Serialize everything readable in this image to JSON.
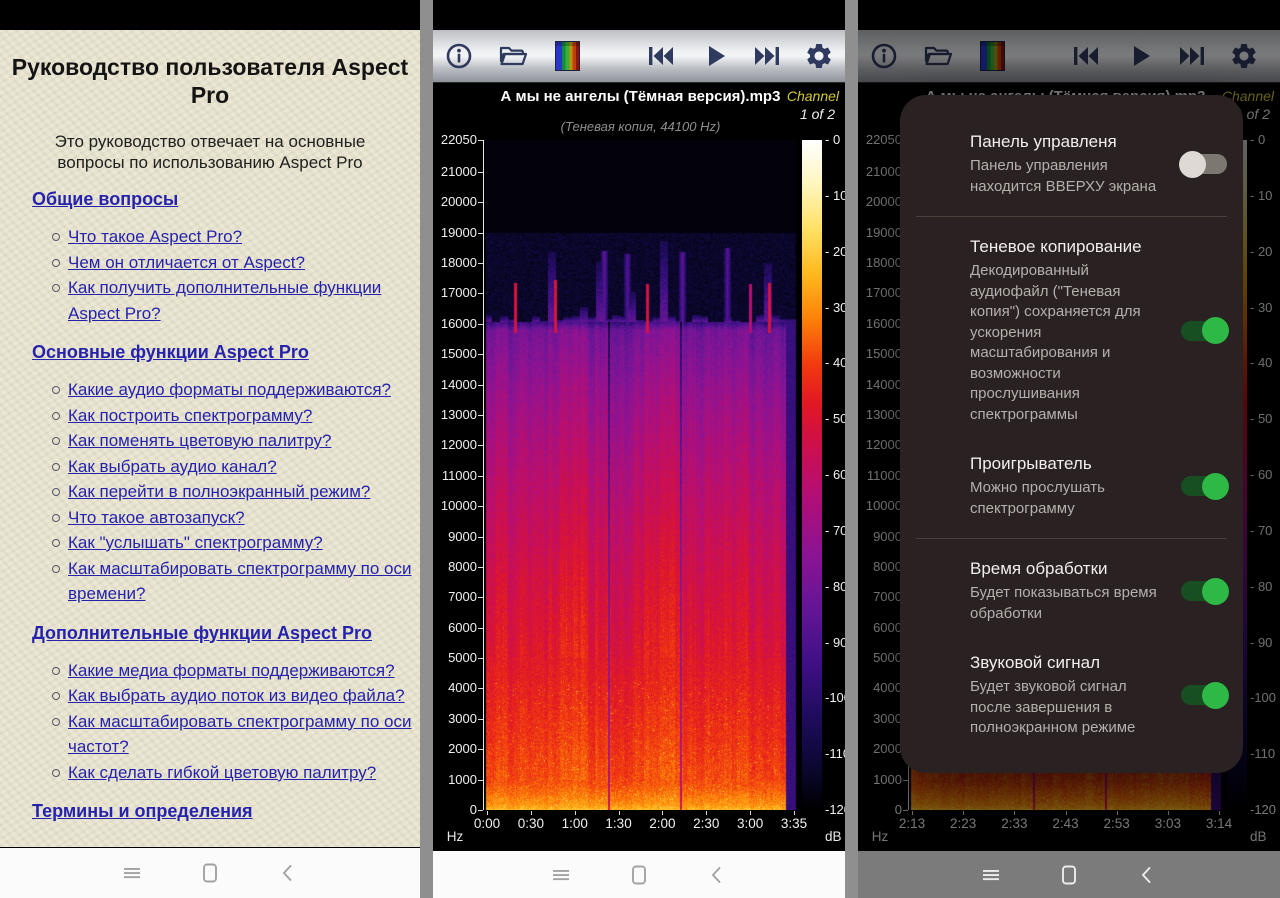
{
  "manual": {
    "title": "Руководство пользователя Aspect Pro",
    "intro": "Это руководство отвечает на основные вопросы по использованию Aspect Pro",
    "sections": [
      {
        "heading": "Общие вопросы",
        "items": [
          "Что такое Aspect Pro?",
          "Чем он отличается от Aspect?",
          "Как получить дополнительные функции Aspect Pro?"
        ]
      },
      {
        "heading": "Основные функции Aspect Pro",
        "items": [
          "Какие аудио форматы поддерживаются?",
          "Как построить спектрограмму?",
          "Как поменять цветовую палитру?",
          "Как выбрать аудио канал?",
          "Как перейти в полноэкранный режим?",
          "Что такое автозапуск?",
          "Как \"услышать\" спектрограмму?",
          "Как масштабировать спектрограмму по оси времени?"
        ]
      },
      {
        "heading": "Дополнительные функции Aspect Pro",
        "items": [
          "Какие медиа форматы поддерживаются?",
          "Как выбрать аудио поток из видео файла?",
          "Как масштабировать спектрограмму по оси частот?",
          "Как сделать гибкой цветовую палитру?"
        ]
      },
      {
        "heading": "Термины и определения",
        "items": []
      }
    ]
  },
  "player": {
    "file_name": "А мы не ангелы (Тёмная версия).mp3",
    "channel_label": "Channel",
    "channel_value": "1 of 2",
    "shadow_copy_note": "(Теневая копия, 44100 Hz)",
    "freq_unit": "Hz",
    "db_unit": "dB",
    "toolbar_icons": [
      "info",
      "open-file",
      "palette",
      "previous",
      "play",
      "next",
      "settings"
    ]
  },
  "nav_bar": {
    "icons": [
      "menu",
      "home",
      "back"
    ]
  },
  "chart_data": {
    "type": "heatmap",
    "title": "Audio spectrogram of А мы не ангелы (Тёмная версия).mp3",
    "xlabel_unit": "time (min:sec)",
    "ylabel_unit": "Hz",
    "value_unit": "dB",
    "freq_range_hz": [
      0,
      22050
    ],
    "db_range": [
      -120,
      0
    ],
    "freq_ticks": [
      22050,
      21000,
      20000,
      19000,
      18000,
      17000,
      16000,
      15000,
      14000,
      13000,
      12000,
      11000,
      10000,
      9000,
      8000,
      7000,
      6000,
      5000,
      4000,
      3000,
      2000,
      1000,
      0
    ],
    "db_tick_labels": [
      "- 0",
      "- 10",
      "- 20",
      "- 30",
      "- 40",
      "- 50",
      "- 60",
      "- 70",
      "- 80",
      "- 90",
      "-100",
      "-110",
      "-120"
    ],
    "middle_time_ticks": [
      "0:00",
      "0:30",
      "1:00",
      "1:30",
      "2:00",
      "2:30",
      "3:00",
      "3:35"
    ],
    "right_time_ticks": [
      "2:13",
      "2:23",
      "2:33",
      "2:43",
      "2:53",
      "3:03",
      "3:14"
    ],
    "spectrogram": {
      "content_cutoff_hz": 16050,
      "profile_points": [
        [
          0,
          -24
        ],
        [
          200,
          -30
        ],
        [
          900,
          -38
        ],
        [
          2500,
          -42
        ],
        [
          5000,
          -48
        ],
        [
          8000,
          -54
        ],
        [
          11000,
          -62
        ],
        [
          13500,
          -70
        ],
        [
          15800,
          -80
        ],
        [
          16100,
          -98
        ],
        [
          17000,
          -112
        ],
        [
          22050,
          -118
        ]
      ],
      "spikes": [
        {
          "t": 0.098,
          "top_hz": 17350,
          "db": -48,
          "wide": false
        },
        {
          "t": 0.225,
          "top_hz": 17450,
          "db": -48,
          "wide": false
        },
        {
          "t": 0.38,
          "top_hz": 18400,
          "db": -86,
          "wide": true
        },
        {
          "t": 0.455,
          "top_hz": 18300,
          "db": -88,
          "wide": true
        },
        {
          "t": 0.518,
          "top_hz": 17300,
          "db": -50,
          "wide": false
        },
        {
          "t": 0.63,
          "top_hz": 18350,
          "db": -86,
          "wide": true
        },
        {
          "t": 0.77,
          "top_hz": 18500,
          "db": -88,
          "wide": true
        },
        {
          "t": 0.845,
          "top_hz": 17300,
          "db": -60,
          "wide": false
        },
        {
          "t": 0.905,
          "top_hz": 17350,
          "db": -48,
          "wide": false
        }
      ],
      "silence_gaps_t": [
        0.394,
        0.625
      ],
      "right_fade_t": [
        0.958,
        0.988
      ],
      "colormap": [
        [
          0,
          255,
          255,
          255
        ],
        [
          -8,
          255,
          246,
          190
        ],
        [
          -16,
          255,
          225,
          100
        ],
        [
          -24,
          255,
          185,
          30
        ],
        [
          -32,
          252,
          130,
          10
        ],
        [
          -40,
          242,
          60,
          15
        ],
        [
          -47,
          225,
          25,
          35
        ],
        [
          -55,
          205,
          15,
          80
        ],
        [
          -64,
          178,
          15,
          120
        ],
        [
          -74,
          140,
          20,
          148
        ],
        [
          -84,
          100,
          22,
          150
        ],
        [
          -94,
          62,
          16,
          132
        ],
        [
          -103,
          32,
          12,
          95
        ],
        [
          -112,
          12,
          8,
          50
        ],
        [
          -120,
          0,
          0,
          0
        ]
      ]
    }
  },
  "settings_dialog": {
    "items": [
      {
        "title": "Панель управленя",
        "subtitle": "Панель управления находится ВВЕРХУ экрана",
        "enabled": false,
        "divider_after": true
      },
      {
        "title": "Теневое копирование",
        "subtitle": "Декодированный аудиофайл (\"Теневая копия\") сохраняется для ускорения масштабирования и возможности прослушивания спектрограммы",
        "enabled": true,
        "divider_after": false
      },
      {
        "title": "Проигрыватель",
        "subtitle": "Можно прослушать спектрограмму",
        "enabled": true,
        "divider_after": true
      },
      {
        "title": "Время обработки",
        "subtitle": "Будет показываться время обработки",
        "enabled": true,
        "divider_after": false
      },
      {
        "title": "Звуковой сигнал",
        "subtitle": "Будет звуковой сигнал после завершения в полноэкранном режиме",
        "enabled": true,
        "divider_after": false
      }
    ],
    "toggle_on_color": "#2eb845",
    "toggle_off_color": "#ded9d5"
  }
}
